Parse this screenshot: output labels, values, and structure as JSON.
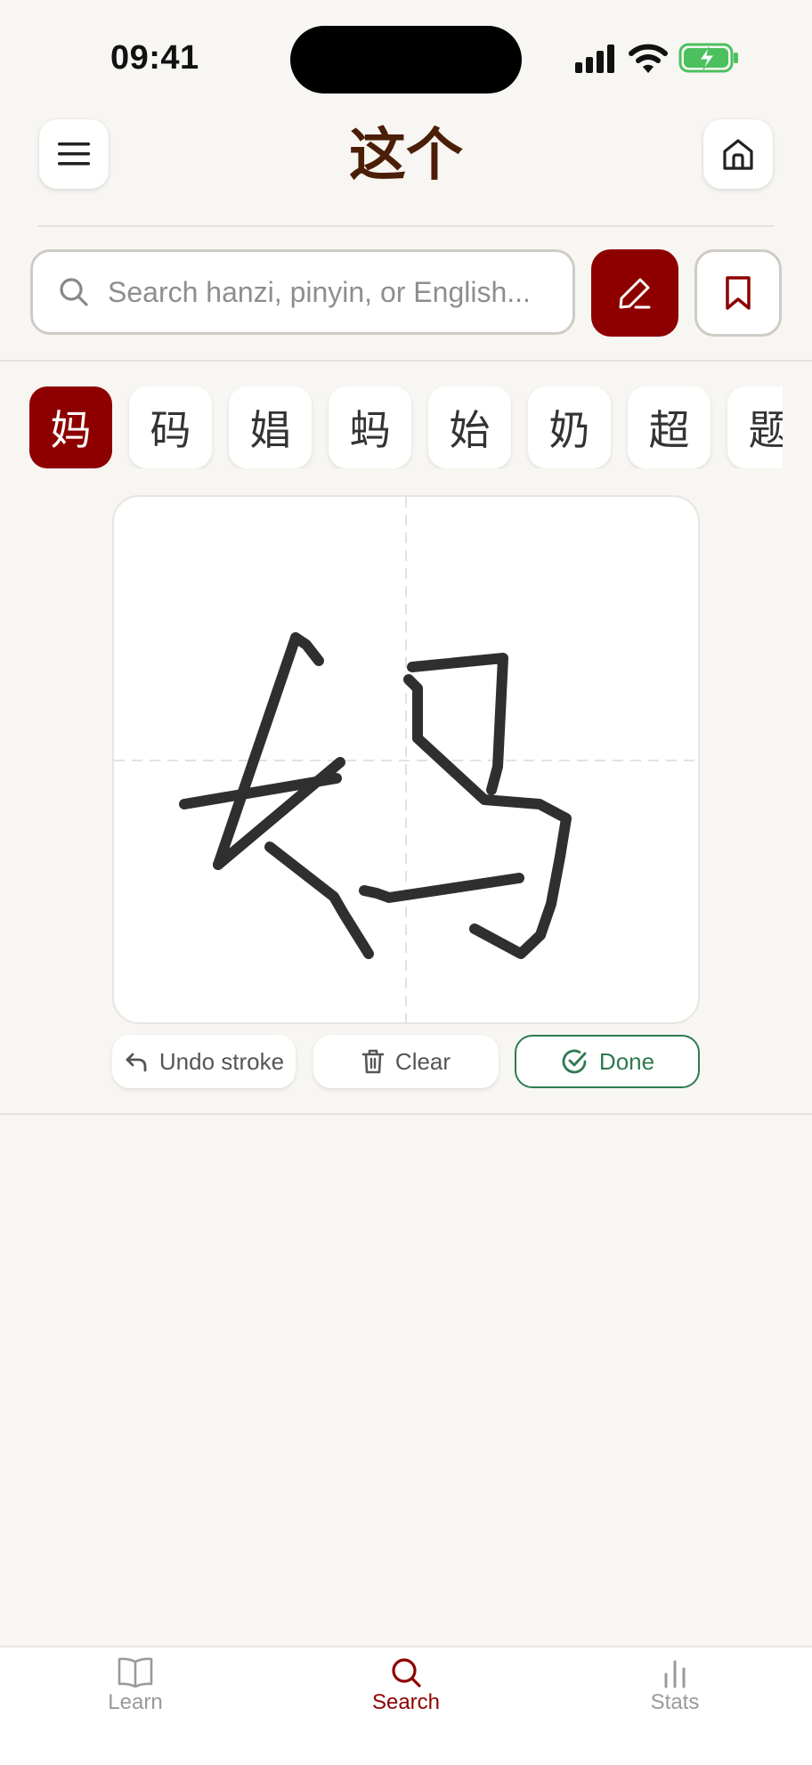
{
  "status_bar": {
    "time": "09:41"
  },
  "header": {
    "app_title": "这个"
  },
  "search": {
    "placeholder": "Search hanzi, pinyin, or English..."
  },
  "candidates": [
    "妈",
    "码",
    "娼",
    "蚂",
    "始",
    "奶",
    "超",
    "题"
  ],
  "selected_candidate": 0,
  "handwriting": {
    "strokes_drawn": 8
  },
  "actions": {
    "undo_label": "Undo stroke",
    "clear_label": "Clear",
    "done_label": "Done"
  },
  "tabs": {
    "learn": "Learn",
    "search": "Search",
    "stats": "Stats",
    "active": "Search"
  },
  "colors": {
    "accent": "#8E0000",
    "success": "#2F7A4F",
    "background": "#F8F6F2",
    "title": "#4A1E07"
  },
  "icons": {
    "menu": "menu-icon",
    "home": "home-icon",
    "search": "search-icon",
    "pen": "pen-icon",
    "bookmark": "bookmark-icon",
    "undo": "undo-icon",
    "trash": "trash-icon",
    "done": "check-circle-icon",
    "learn": "book-icon",
    "stats": "bar-chart-icon"
  }
}
